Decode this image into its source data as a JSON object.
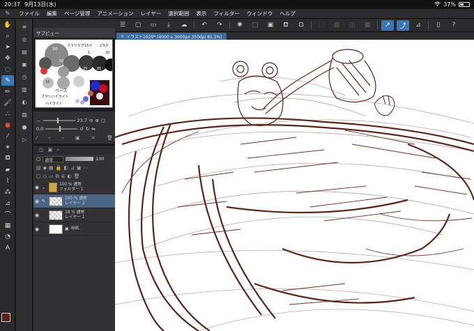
{
  "status": {
    "time": "20:37",
    "date": "9月13日(水)",
    "wifi": "wifi-icon",
    "battery": "37%"
  },
  "menu": [
    "ファイル",
    "編集",
    "ページ管理",
    "アニメーション",
    "レイヤー",
    "選択範囲",
    "表示",
    "フィルター",
    "ウィンドウ",
    "ヘルプ"
  ],
  "navigator": {
    "title": "サブビュー",
    "zoom": "23.7",
    "rotation": "0.0",
    "notes": [
      "50",
      "ブラリゲグ",
      "15ゲ",
      "2.5ゲ",
      "1",
      "20",
      "50",
      "75",
      "85",
      "10",
      "ベース",
      "ブラシハイライト",
      "ハイライト"
    ]
  },
  "layers": {
    "blend_mode": "通常",
    "opacity": "100",
    "items": [
      {
        "opacity_mode": "100 % 通常",
        "name": "フォルダー 1",
        "kind": "folder"
      },
      {
        "opacity_mode": "100 % 通常",
        "name": "レイヤー 2",
        "kind": "raster",
        "selected": true
      },
      {
        "opacity_mode": "18 % 通常",
        "name": "レイヤー 1",
        "kind": "raster"
      },
      {
        "opacity_mode": "",
        "name": "用紙",
        "kind": "paper"
      }
    ]
  },
  "document": {
    "tab_label": "イラスト1029* (4000 x 3000px 350dpi 81.3%)"
  },
  "colors": {
    "main": "#5a1c16",
    "sub": "#ffffff",
    "accent": "#3b77b6",
    "sketch": "#5a2418"
  }
}
